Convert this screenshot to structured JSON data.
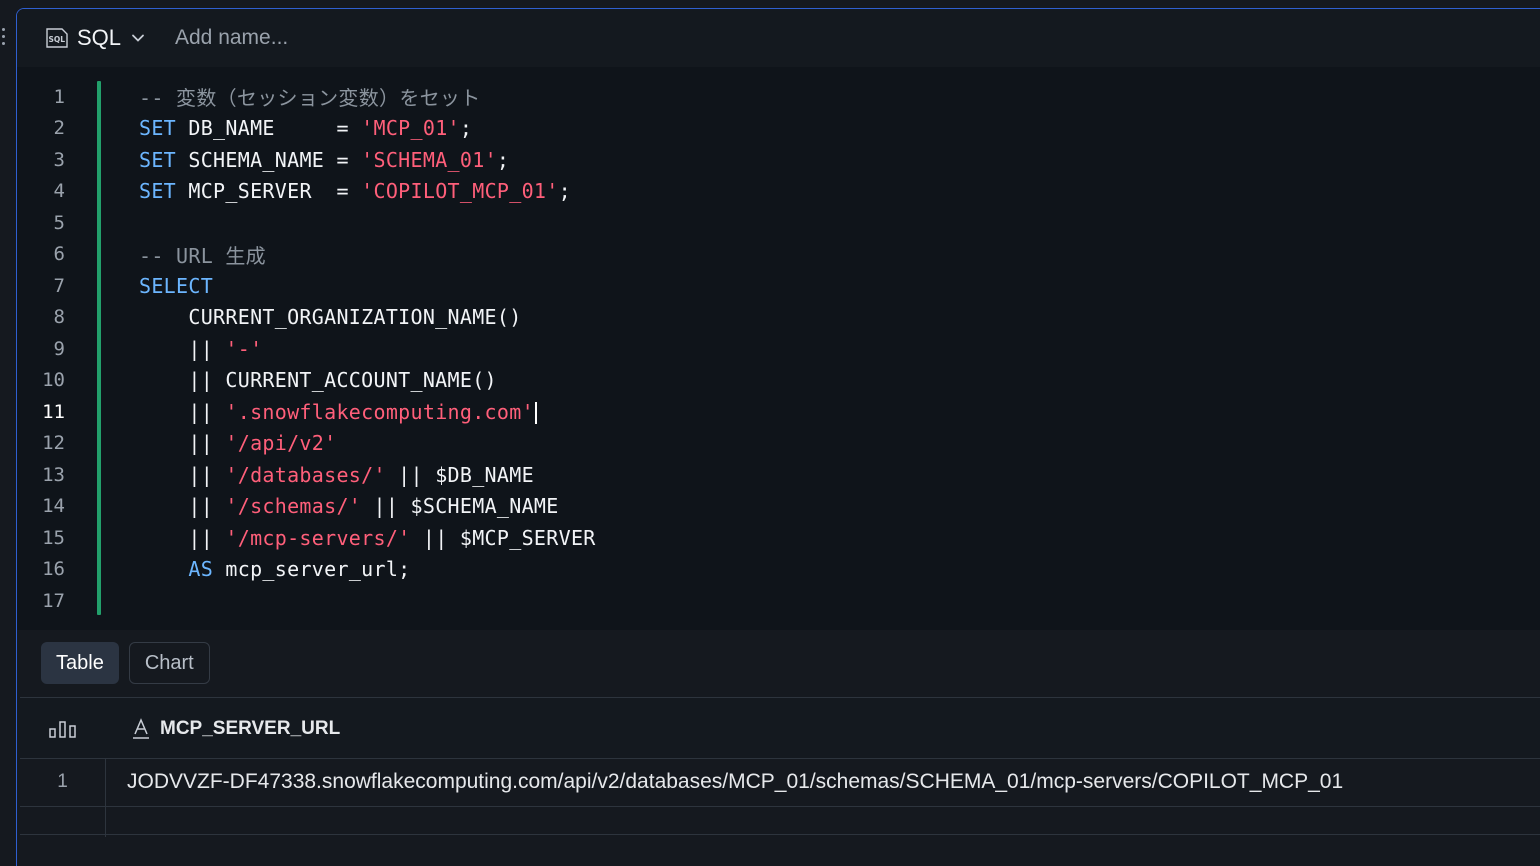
{
  "header": {
    "language_label": "SQL",
    "language_icon": "sql-icon",
    "name_placeholder": "Add name..."
  },
  "editor": {
    "active_line": 11,
    "lines": [
      {
        "n": "1",
        "tokens": [
          {
            "t": "cmt",
            "v": "-- 変数（セッション変数）をセット"
          }
        ]
      },
      {
        "n": "2",
        "tokens": [
          {
            "t": "kw",
            "v": "SET"
          },
          {
            "t": "id",
            "v": " DB_NAME     = "
          },
          {
            "t": "str",
            "v": "'MCP_01'"
          },
          {
            "t": "id",
            "v": ";"
          }
        ]
      },
      {
        "n": "3",
        "tokens": [
          {
            "t": "kw",
            "v": "SET"
          },
          {
            "t": "id",
            "v": " SCHEMA_NAME = "
          },
          {
            "t": "str",
            "v": "'SCHEMA_01'"
          },
          {
            "t": "id",
            "v": ";"
          }
        ]
      },
      {
        "n": "4",
        "tokens": [
          {
            "t": "kw",
            "v": "SET"
          },
          {
            "t": "id",
            "v": " MCP_SERVER  = "
          },
          {
            "t": "str",
            "v": "'COPILOT_MCP_01'"
          },
          {
            "t": "id",
            "v": ";"
          }
        ]
      },
      {
        "n": "5",
        "tokens": []
      },
      {
        "n": "6",
        "tokens": [
          {
            "t": "cmt",
            "v": "-- URL 生成"
          }
        ]
      },
      {
        "n": "7",
        "tokens": [
          {
            "t": "kw",
            "v": "SELECT"
          }
        ]
      },
      {
        "n": "8",
        "tokens": [
          {
            "t": "id",
            "v": "    CURRENT_ORGANIZATION_NAME()"
          }
        ]
      },
      {
        "n": "9",
        "tokens": [
          {
            "t": "id",
            "v": "    || "
          },
          {
            "t": "str",
            "v": "'-'"
          }
        ]
      },
      {
        "n": "10",
        "tokens": [
          {
            "t": "id",
            "v": "    || CURRENT_ACCOUNT_NAME()"
          }
        ]
      },
      {
        "n": "11",
        "tokens": [
          {
            "t": "id",
            "v": "    || "
          },
          {
            "t": "str",
            "v": "'.snowflakecomputing.com'"
          },
          {
            "t": "caret",
            "v": ""
          }
        ]
      },
      {
        "n": "12",
        "tokens": [
          {
            "t": "id",
            "v": "    || "
          },
          {
            "t": "str",
            "v": "'/api/v2'"
          }
        ]
      },
      {
        "n": "13",
        "tokens": [
          {
            "t": "id",
            "v": "    || "
          },
          {
            "t": "str",
            "v": "'/databases/'"
          },
          {
            "t": "id",
            "v": " || $DB_NAME"
          }
        ]
      },
      {
        "n": "14",
        "tokens": [
          {
            "t": "id",
            "v": "    || "
          },
          {
            "t": "str",
            "v": "'/schemas/'"
          },
          {
            "t": "id",
            "v": " || $SCHEMA_NAME"
          }
        ]
      },
      {
        "n": "15",
        "tokens": [
          {
            "t": "id",
            "v": "    || "
          },
          {
            "t": "str",
            "v": "'/mcp-servers/'"
          },
          {
            "t": "id",
            "v": " || $MCP_SERVER"
          }
        ]
      },
      {
        "n": "16",
        "tokens": [
          {
            "t": "id",
            "v": "    "
          },
          {
            "t": "kw",
            "v": "AS"
          },
          {
            "t": "id",
            "v": " mcp_server_url;"
          }
        ]
      },
      {
        "n": "17",
        "tokens": []
      }
    ]
  },
  "results": {
    "tabs": [
      {
        "label": "Table",
        "active": true
      },
      {
        "label": "Chart",
        "active": false
      }
    ],
    "column": {
      "name": "MCP_SERVER_URL",
      "type_icon": "text-type-icon"
    },
    "stats_icon": "column-stats-icon",
    "rows": [
      {
        "num": "1",
        "value": "JODVVZF-DF47338.snowflakecomputing.com/api/v2/databases/MCP_01/schemas/SCHEMA_01/mcp-servers/COPILOT_MCP_01"
      }
    ]
  },
  "colors": {
    "accent_border": "#2f5fd0",
    "gutter_bar": "#22a06b",
    "keyword": "#6cb6ff",
    "string": "#ff5f7a",
    "comment": "#8b949e"
  }
}
